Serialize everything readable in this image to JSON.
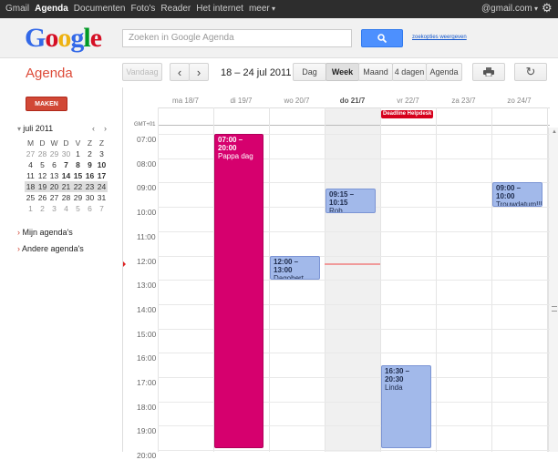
{
  "topbar": {
    "nav": [
      "Gmail",
      "Agenda",
      "Documenten",
      "Foto's",
      "Reader",
      "Het internet",
      "meer"
    ],
    "account": "@gmail.com"
  },
  "header": {
    "logo": [
      "G",
      "o",
      "o",
      "g",
      "l",
      "e"
    ],
    "logo_colors": [
      "#3369e8",
      "#d50f25",
      "#eeb211",
      "#3369e8",
      "#009925",
      "#d50f25"
    ],
    "search_placeholder": "Zoeken in Google Agenda",
    "search_options": "zoekopties weergeven"
  },
  "toolbar": {
    "title": "Agenda",
    "today": "Vandaag",
    "prev": "‹",
    "next": "›",
    "date_range": "18 – 24  jul 2011",
    "views": [
      "Dag",
      "Week",
      "Maand",
      "4 dagen",
      "Agenda"
    ],
    "selected_view": "Week"
  },
  "sidebar": {
    "create": "MAKEN",
    "month": "juli 2011",
    "weekdays": [
      "M",
      "D",
      "W",
      "D",
      "V",
      "Z",
      "Z"
    ],
    "weeks": [
      [
        "27",
        "28",
        "29",
        "30",
        "1",
        "2",
        "3"
      ],
      [
        "4",
        "5",
        "6",
        "7",
        "8",
        "9",
        "10"
      ],
      [
        "11",
        "12",
        "13",
        "14",
        "15",
        "16",
        "17"
      ],
      [
        "18",
        "19",
        "20",
        "21",
        "22",
        "23",
        "24"
      ],
      [
        "25",
        "26",
        "27",
        "28",
        "29",
        "30",
        "31"
      ],
      [
        "1",
        "2",
        "3",
        "4",
        "5",
        "6",
        "7"
      ]
    ],
    "my_calendars": "Mijn agenda's",
    "other_calendars": "Andere agenda's"
  },
  "week": {
    "days": [
      "ma 18/7",
      "di 19/7",
      "wo 20/7",
      "do 21/7",
      "vr 22/7",
      "za 23/7",
      "zo 24/7"
    ],
    "timezone": "GMT+01",
    "hours": [
      "07:00",
      "08:00",
      "09:00",
      "10:00",
      "11:00",
      "12:00",
      "13:00",
      "14:00",
      "15:00",
      "16:00",
      "17:00",
      "18:00",
      "19:00",
      "20:00"
    ],
    "allday_event": {
      "title": "Deadline Helpdesk",
      "day": 4
    },
    "events": [
      {
        "time": "07:00 – 20:00",
        "title": "Pappa dag",
        "day": 1,
        "start": 7.0,
        "end": 20.0,
        "color": "pink"
      },
      {
        "time": "09:15 – 10:15",
        "title": "Rob",
        "day": 3,
        "start": 9.25,
        "end": 10.25,
        "color": "blue"
      },
      {
        "time": "09:00 – 10:00",
        "title": "Trouwdatum!!!",
        "day": 6,
        "start": 9.0,
        "end": 10.0,
        "color": "blue"
      },
      {
        "time": "12:00 – 13:00",
        "title": "Dagobert",
        "day": 2,
        "start": 12.0,
        "end": 13.0,
        "color": "blue"
      },
      {
        "time": "16:30 – 20:30",
        "title": "Linda",
        "day": 4,
        "start": 16.5,
        "end": 20.5,
        "color": "blue"
      }
    ],
    "now_hour": 12.33,
    "today_index": 3
  }
}
